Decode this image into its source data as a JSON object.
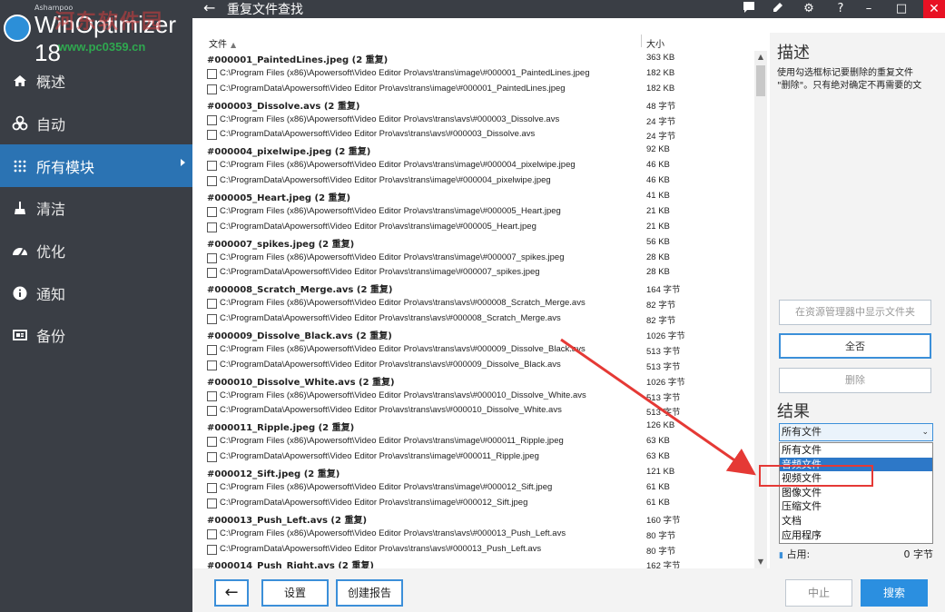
{
  "app": {
    "brand_small": "Ashampoo",
    "brand": "WinOptimizer 18",
    "watermark_cn": "河东软件园",
    "watermark_url": "www.pc0359.cn"
  },
  "sidebar": {
    "items": [
      {
        "label": "概述",
        "icon": "home-icon"
      },
      {
        "label": "自动",
        "icon": "biohazard-icon"
      },
      {
        "label": "所有模块",
        "icon": "grid-dots-icon"
      },
      {
        "label": "清洁",
        "icon": "broom-icon"
      },
      {
        "label": "优化",
        "icon": "gauge-icon"
      },
      {
        "label": "通知",
        "icon": "info-icon"
      },
      {
        "label": "备份",
        "icon": "backup-icon"
      }
    ]
  },
  "titlebar": {
    "title": "重复文件查找",
    "back_icon": "back-arrow-icon"
  },
  "filelist": {
    "header_file": "文件",
    "header_size": "大小",
    "rows": [
      {
        "type": "group",
        "name": "#000001_PaintedLines.jpeg (2 重复)",
        "size": "363 KB"
      },
      {
        "type": "file",
        "path": "C:\\Program Files (x86)\\Apowersoft\\Video Editor Pro\\avs\\trans\\image\\#000001_PaintedLines.jpeg",
        "size": "182 KB"
      },
      {
        "type": "file",
        "path": "C:\\ProgramData\\Apowersoft\\Video Editor Pro\\avs\\trans\\image\\#000001_PaintedLines.jpeg",
        "size": "182 KB"
      },
      {
        "type": "group",
        "name": "#000003_Dissolve.avs (2 重复)",
        "size": "48 字节"
      },
      {
        "type": "file",
        "path": "C:\\Program Files (x86)\\Apowersoft\\Video Editor Pro\\avs\\trans\\avs\\#000003_Dissolve.avs",
        "size": "24 字节"
      },
      {
        "type": "file",
        "path": "C:\\ProgramData\\Apowersoft\\Video Editor Pro\\avs\\trans\\avs\\#000003_Dissolve.avs",
        "size": "24 字节"
      },
      {
        "type": "group",
        "name": "#000004_pixelwipe.jpeg (2 重复)",
        "size": "92 KB"
      },
      {
        "type": "file",
        "path": "C:\\Program Files (x86)\\Apowersoft\\Video Editor Pro\\avs\\trans\\image\\#000004_pixelwipe.jpeg",
        "size": "46 KB"
      },
      {
        "type": "file",
        "path": "C:\\ProgramData\\Apowersoft\\Video Editor Pro\\avs\\trans\\image\\#000004_pixelwipe.jpeg",
        "size": "46 KB"
      },
      {
        "type": "group",
        "name": "#000005_Heart.jpeg (2 重复)",
        "size": "41 KB"
      },
      {
        "type": "file",
        "path": "C:\\Program Files (x86)\\Apowersoft\\Video Editor Pro\\avs\\trans\\image\\#000005_Heart.jpeg",
        "size": "21 KB"
      },
      {
        "type": "file",
        "path": "C:\\ProgramData\\Apowersoft\\Video Editor Pro\\avs\\trans\\image\\#000005_Heart.jpeg",
        "size": "21 KB"
      },
      {
        "type": "group",
        "name": "#000007_spikes.jpeg (2 重复)",
        "size": "56 KB"
      },
      {
        "type": "file",
        "path": "C:\\Program Files (x86)\\Apowersoft\\Video Editor Pro\\avs\\trans\\image\\#000007_spikes.jpeg",
        "size": "28 KB"
      },
      {
        "type": "file",
        "path": "C:\\ProgramData\\Apowersoft\\Video Editor Pro\\avs\\trans\\image\\#000007_spikes.jpeg",
        "size": "28 KB"
      },
      {
        "type": "group",
        "name": "#000008_Scratch_Merge.avs (2 重复)",
        "size": "164 字节"
      },
      {
        "type": "file",
        "path": "C:\\Program Files (x86)\\Apowersoft\\Video Editor Pro\\avs\\trans\\avs\\#000008_Scratch_Merge.avs",
        "size": "82 字节"
      },
      {
        "type": "file",
        "path": "C:\\ProgramData\\Apowersoft\\Video Editor Pro\\avs\\trans\\avs\\#000008_Scratch_Merge.avs",
        "size": "82 字节"
      },
      {
        "type": "group",
        "name": "#000009_Dissolve_Black.avs (2 重复)",
        "size": "1026 字节"
      },
      {
        "type": "file",
        "path": "C:\\Program Files (x86)\\Apowersoft\\Video Editor Pro\\avs\\trans\\avs\\#000009_Dissolve_Black.avs",
        "size": "513 字节"
      },
      {
        "type": "file",
        "path": "C:\\ProgramData\\Apowersoft\\Video Editor Pro\\avs\\trans\\avs\\#000009_Dissolve_Black.avs",
        "size": "513 字节"
      },
      {
        "type": "group",
        "name": "#000010_Dissolve_White.avs (2 重复)",
        "size": "1026 字节"
      },
      {
        "type": "file",
        "path": "C:\\Program Files (x86)\\Apowersoft\\Video Editor Pro\\avs\\trans\\avs\\#000010_Dissolve_White.avs",
        "size": "513 字节"
      },
      {
        "type": "file",
        "path": "C:\\ProgramData\\Apowersoft\\Video Editor Pro\\avs\\trans\\avs\\#000010_Dissolve_White.avs",
        "size": "513 字节"
      },
      {
        "type": "group",
        "name": "#000011_Ripple.jpeg (2 重复)",
        "size": "126 KB"
      },
      {
        "type": "file",
        "path": "C:\\Program Files (x86)\\Apowersoft\\Video Editor Pro\\avs\\trans\\image\\#000011_Ripple.jpeg",
        "size": "63 KB"
      },
      {
        "type": "file",
        "path": "C:\\ProgramData\\Apowersoft\\Video Editor Pro\\avs\\trans\\image\\#000011_Ripple.jpeg",
        "size": "63 KB"
      },
      {
        "type": "group",
        "name": "#000012_Sift.jpeg (2 重复)",
        "size": "121 KB"
      },
      {
        "type": "file",
        "path": "C:\\Program Files (x86)\\Apowersoft\\Video Editor Pro\\avs\\trans\\image\\#000012_Sift.jpeg",
        "size": "61 KB"
      },
      {
        "type": "file",
        "path": "C:\\ProgramData\\Apowersoft\\Video Editor Pro\\avs\\trans\\image\\#000012_Sift.jpeg",
        "size": "61 KB"
      },
      {
        "type": "group",
        "name": "#000013_Push_Left.avs (2 重复)",
        "size": "160 字节"
      },
      {
        "type": "file",
        "path": "C:\\Program Files (x86)\\Apowersoft\\Video Editor Pro\\avs\\trans\\avs\\#000013_Push_Left.avs",
        "size": "80 字节"
      },
      {
        "type": "file",
        "path": "C:\\ProgramData\\Apowersoft\\Video Editor Pro\\avs\\trans\\avs\\#000013_Push_Left.avs",
        "size": "80 字节"
      },
      {
        "type": "group",
        "name": "#000014_Push_Right.avs (2 重复)",
        "size": "162 字节"
      }
    ]
  },
  "rightpanel": {
    "desc_title": "描述",
    "desc_line1": "使用勾选框标记要删除的重复文件",
    "desc_line2": "\"删除\"。只有绝对确定不再需要的文",
    "btn_show_in_explorer": "在资源管理器中显示文件夹",
    "btn_select_all": "全否",
    "btn_delete": "删除",
    "result_title": "结果",
    "filter_selected": "所有文件",
    "filter_options": [
      "所有文件",
      "音频文件",
      "视频文件",
      "图像文件",
      "压缩文件",
      "文档",
      "应用程序"
    ],
    "filter_highlighted_index": 1,
    "usage_label": "占用:",
    "usage_value": "0 字节"
  },
  "bottombar": {
    "btn_settings": "设置",
    "btn_report": "创建报告",
    "btn_stop": "中止",
    "btn_search": "搜索"
  },
  "colors": {
    "sidebar_bg": "#3a3e45",
    "active_nav": "#2b73b3",
    "accent": "#3b8fd9",
    "close_red": "#e81123",
    "annotation_red": "#e53935"
  }
}
